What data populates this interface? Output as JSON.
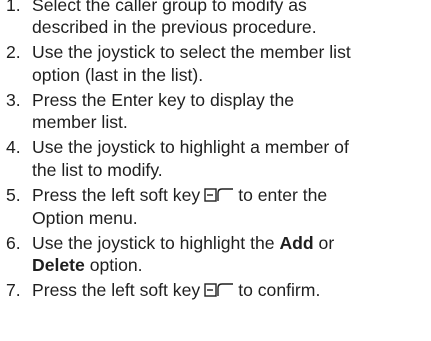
{
  "steps": [
    {
      "number": "1.",
      "lines": [
        "Select the caller group to modify as",
        "described in the previous procedure."
      ]
    },
    {
      "number": "2.",
      "lines": [
        "Use the joystick to select the member list",
        "option (last in the list)."
      ]
    },
    {
      "number": "3.",
      "lines": [
        "Press the Enter key to display the",
        "member list."
      ]
    },
    {
      "number": "4.",
      "lines": [
        "Use the joystick to highlight a member of",
        "the list to modify."
      ]
    },
    {
      "number": "5.",
      "line1_before": "Press the left soft key",
      "line1_after": "to enter the",
      "line2": "Option menu.",
      "icon": "left-soft-key-icon"
    },
    {
      "number": "6.",
      "line1": "Use the joystick to highlight the",
      "bold1": "Add",
      "or_text": "or",
      "bold2": "Delete",
      "line2_after": "option."
    },
    {
      "number": "7.",
      "line1_before": "Press the left soft key",
      "line1_after": "to confirm.",
      "icon": "left-soft-key-icon"
    }
  ]
}
